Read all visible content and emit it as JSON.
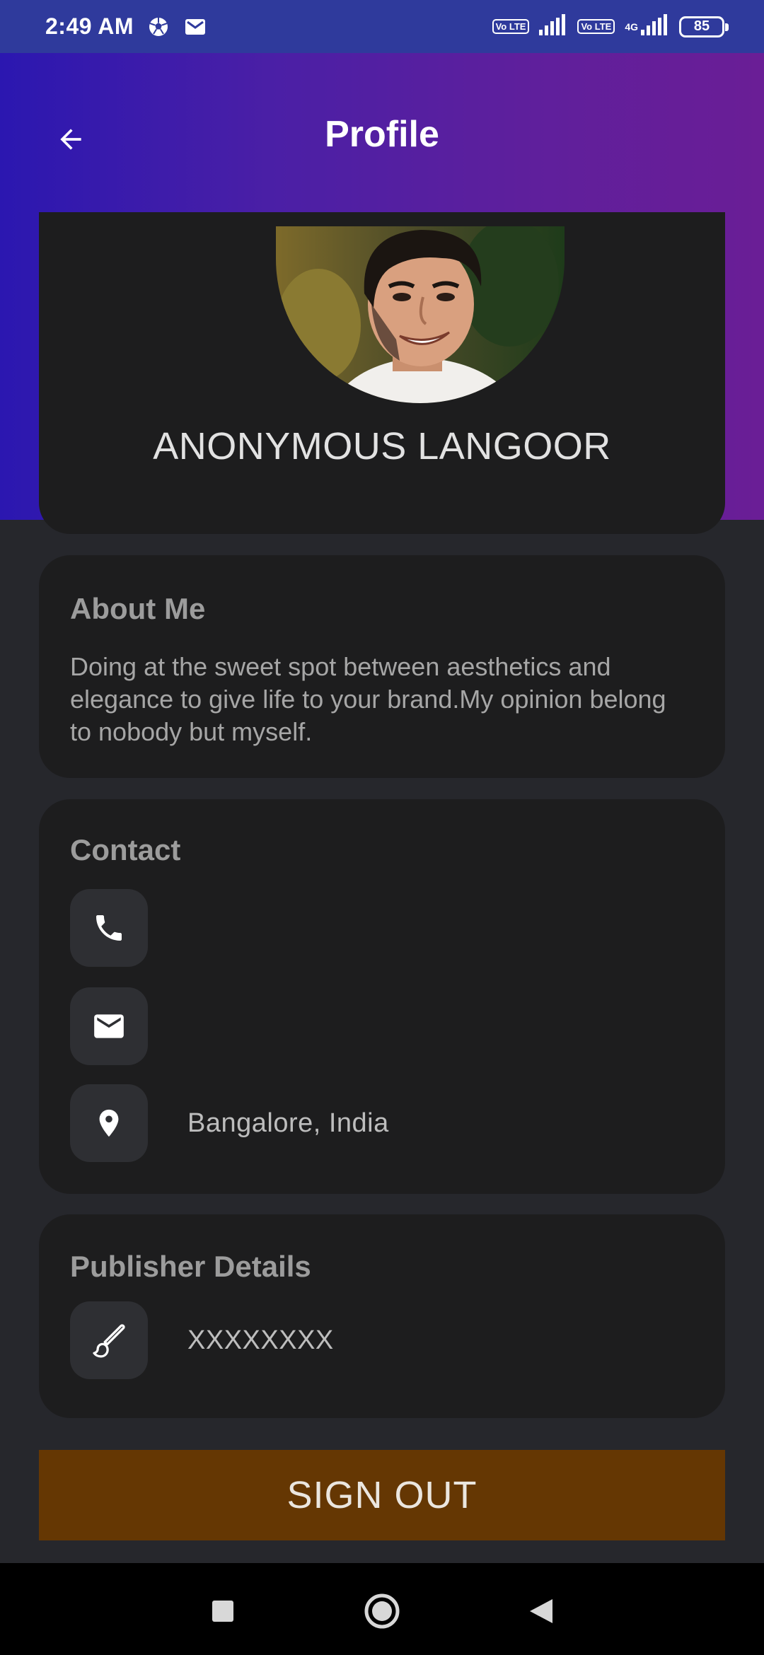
{
  "status_bar": {
    "time": "2:49 AM",
    "sim1_label": "Vo LTE",
    "sim2_label": "Vo LTE",
    "network_label": "4G",
    "battery": "85"
  },
  "app_bar": {
    "title": "Profile"
  },
  "profile": {
    "name": "ANONYMOUS LANGOOR"
  },
  "about": {
    "title": "About Me",
    "text": "Doing at the sweet spot between aesthetics and elegance to give life to your brand.My opinion belong to nobody but myself."
  },
  "contact": {
    "title": "Contact",
    "phone": "",
    "email": "",
    "location": "Bangalore, India"
  },
  "publisher": {
    "title": "Publisher Details",
    "value": "XXXXXXXX"
  },
  "sign_out_label": "SIGN OUT",
  "colors": {
    "header_gradient_start": "#2b17b0",
    "header_gradient_end": "#6a1e96",
    "card_bg": "#1d1d1e",
    "page_bg": "#26272c",
    "sign_out_bg": "#653703"
  }
}
